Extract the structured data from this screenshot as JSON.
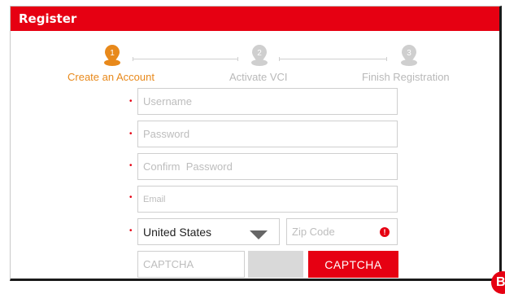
{
  "window": {
    "title": "Register"
  },
  "steps": [
    {
      "number": "1",
      "label": "Create an Account",
      "state": "active"
    },
    {
      "number": "2",
      "label": "Activate VCI",
      "state": "inactive"
    },
    {
      "number": "3",
      "label": "Finish Registration",
      "state": "inactive"
    }
  ],
  "form": {
    "required_mark": "•",
    "username": {
      "placeholder": "Username"
    },
    "password": {
      "placeholder": "Password"
    },
    "confirm_password": {
      "placeholder": "Confirm  Password"
    },
    "email": {
      "placeholder": "Email"
    },
    "country": {
      "selected": "United States"
    },
    "zip": {
      "placeholder": "Zip Code",
      "error_mark": "!"
    },
    "captcha": {
      "placeholder": "CAPTCHA",
      "button_label": "CAPTCHA"
    }
  },
  "badge": {
    "letter": "B"
  },
  "colors": {
    "brand_red": "#e60012",
    "active_step": "#e8891b",
    "inactive_step": "#b9b9b9"
  }
}
